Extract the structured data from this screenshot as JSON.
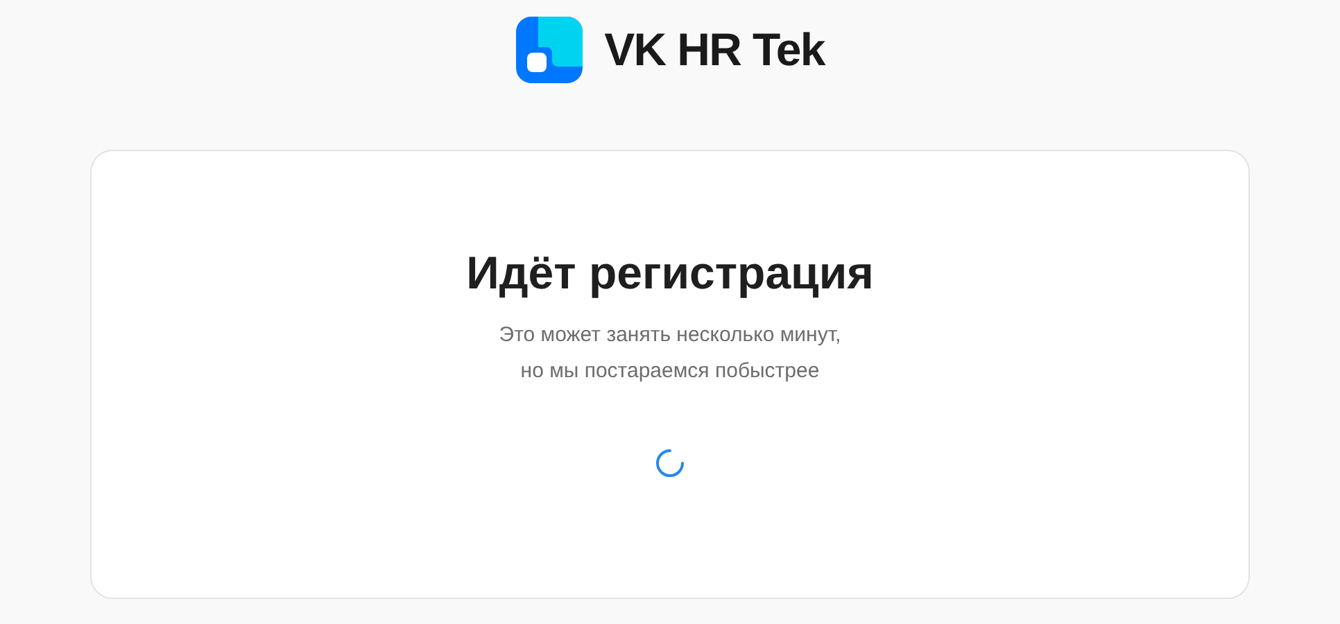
{
  "header": {
    "logo_text": "VK HR Tek"
  },
  "card": {
    "title": "Идёт регистрация",
    "subtitle_lines": [
      "Это может занять несколько минут,",
      "но мы постараемся побыстрее"
    ],
    "loading": true
  }
}
